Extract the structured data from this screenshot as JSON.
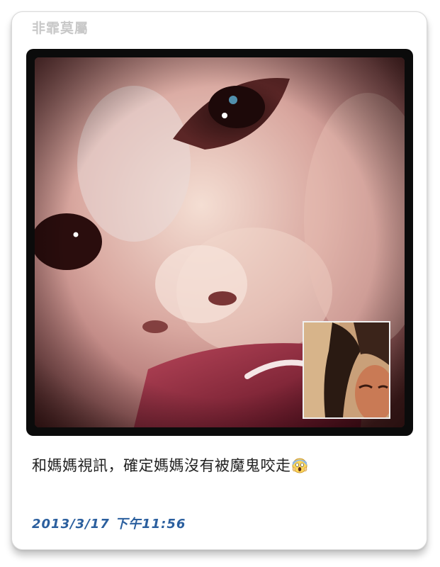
{
  "post": {
    "author": "非霏莫屬",
    "caption": "和媽媽視訊，確定媽媽沒有被魔鬼咬走",
    "emoji_icon": "face-screaming-in-fear-icon",
    "timestamp": "2013/3/17 下午11:56"
  },
  "photo": {
    "main_subject": "baby-face-closeup",
    "inset_subject": "mother-video-call-inset"
  }
}
